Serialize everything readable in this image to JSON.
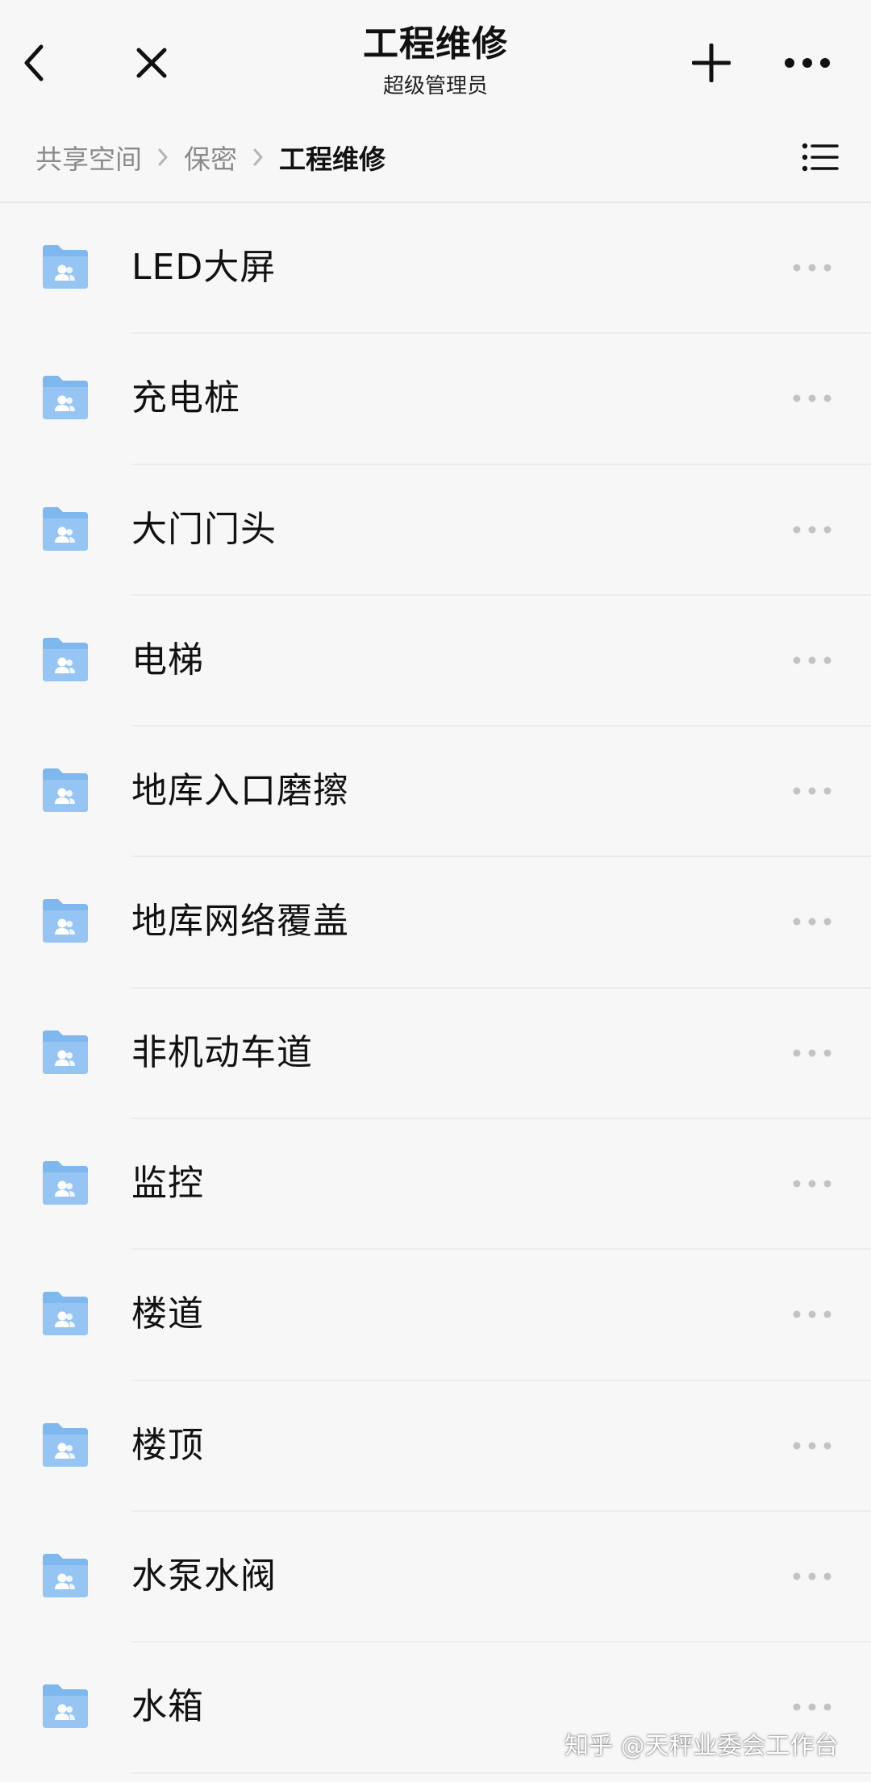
{
  "header": {
    "title": "工程维修",
    "subtitle": "超级管理员",
    "back_icon": "chevron-left-icon",
    "close_icon": "close-icon",
    "add_icon": "plus-icon",
    "more_icon": "more-horizontal-icon"
  },
  "breadcrumb": {
    "items": [
      "共享空间",
      "保密",
      "工程维修"
    ],
    "view_icon": "list-view-icon"
  },
  "colors": {
    "folder_blue": "#7eb8ef",
    "folder_blue_light": "#a9cff5",
    "text_primary": "#111111",
    "text_secondary": "#8a8a8a",
    "dots": "#c3c3c3",
    "background": "#f7f7f7"
  },
  "folders": [
    {
      "name": "LED大屏"
    },
    {
      "name": "充电桩"
    },
    {
      "name": "大门门头"
    },
    {
      "name": "电梯"
    },
    {
      "name": "地库入口磨擦"
    },
    {
      "name": "地库网络覆盖"
    },
    {
      "name": "非机动车道"
    },
    {
      "name": "监控"
    },
    {
      "name": "楼道"
    },
    {
      "name": "楼顶"
    },
    {
      "name": "水泵水阀"
    },
    {
      "name": "水箱"
    }
  ],
  "watermark": "知乎 @天秤业委会工作台"
}
